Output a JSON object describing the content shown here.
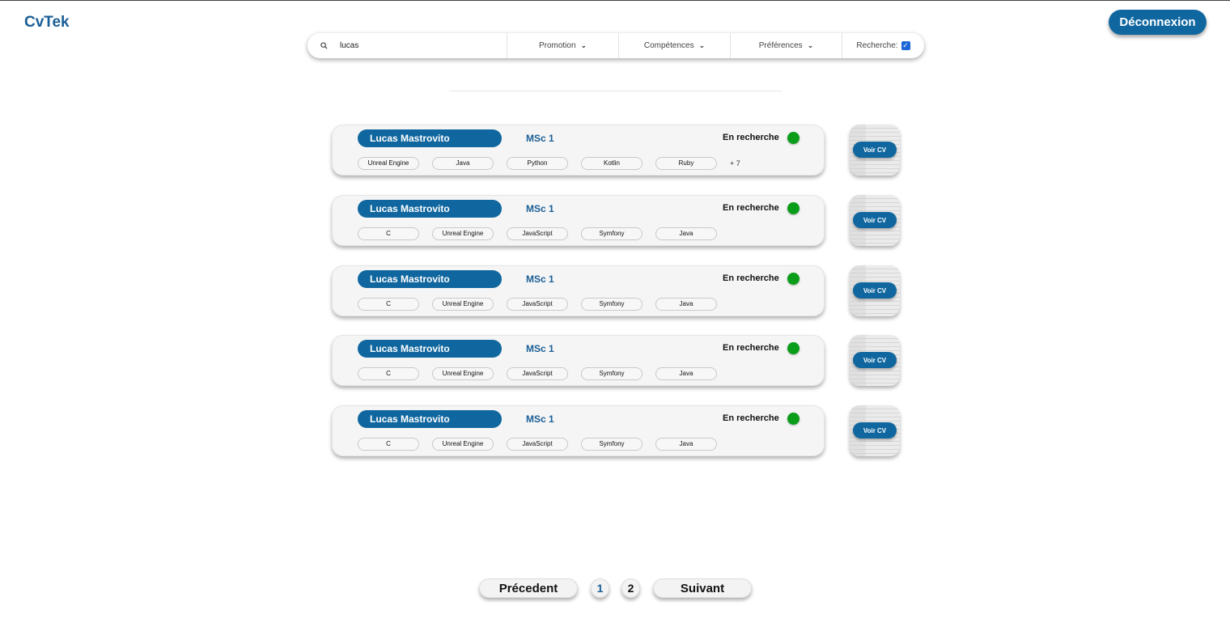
{
  "header": {
    "logo": "CvTek",
    "logout_label": "Déconnexion"
  },
  "search": {
    "value": "lucas",
    "filters": {
      "promotion": "Promotion",
      "competences": "Compétences",
      "preferences": "Préférences"
    },
    "recherche_label": "Recherche:",
    "recherche_checked": true
  },
  "results": [
    {
      "name": "Lucas Mastrovito",
      "promo": "MSc 1",
      "status": "En recherche",
      "skills": [
        "Unreal Engine",
        "Java",
        "Python",
        "Kotlin",
        "Ruby"
      ],
      "more": "+ 7",
      "cv_label": "Voir CV"
    },
    {
      "name": "Lucas Mastrovito",
      "promo": "MSc 1",
      "status": "En recherche",
      "skills": [
        "C",
        "Unreal Engine",
        "JavaScript",
        "Symfony",
        "Java"
      ],
      "more": "",
      "cv_label": "Voir CV"
    },
    {
      "name": "Lucas Mastrovito",
      "promo": "MSc 1",
      "status": "En recherche",
      "skills": [
        "C",
        "Unreal Engine",
        "JavaScript",
        "Symfony",
        "Java"
      ],
      "more": "",
      "cv_label": "Voir CV"
    },
    {
      "name": "Lucas Mastrovito",
      "promo": "MSc 1",
      "status": "En recherche",
      "skills": [
        "C",
        "Unreal Engine",
        "JavaScript",
        "Symfony",
        "Java"
      ],
      "more": "",
      "cv_label": "Voir CV"
    },
    {
      "name": "Lucas Mastrovito",
      "promo": "MSc 1",
      "status": "En recherche",
      "skills": [
        "C",
        "Unreal Engine",
        "JavaScript",
        "Symfony",
        "Java"
      ],
      "more": "",
      "cv_label": "Voir CV"
    }
  ],
  "pagination": {
    "prev_label": "Précedent",
    "pages": [
      "1",
      "2"
    ],
    "current_page": "1",
    "next_label": "Suivant"
  },
  "colors": {
    "brand": "#10679f",
    "status_active": "#0a9d1a"
  },
  "icons": {
    "search": "search-icon",
    "dropdown": "chevron-down-icon",
    "checkbox": "checkbox-checked-icon"
  }
}
